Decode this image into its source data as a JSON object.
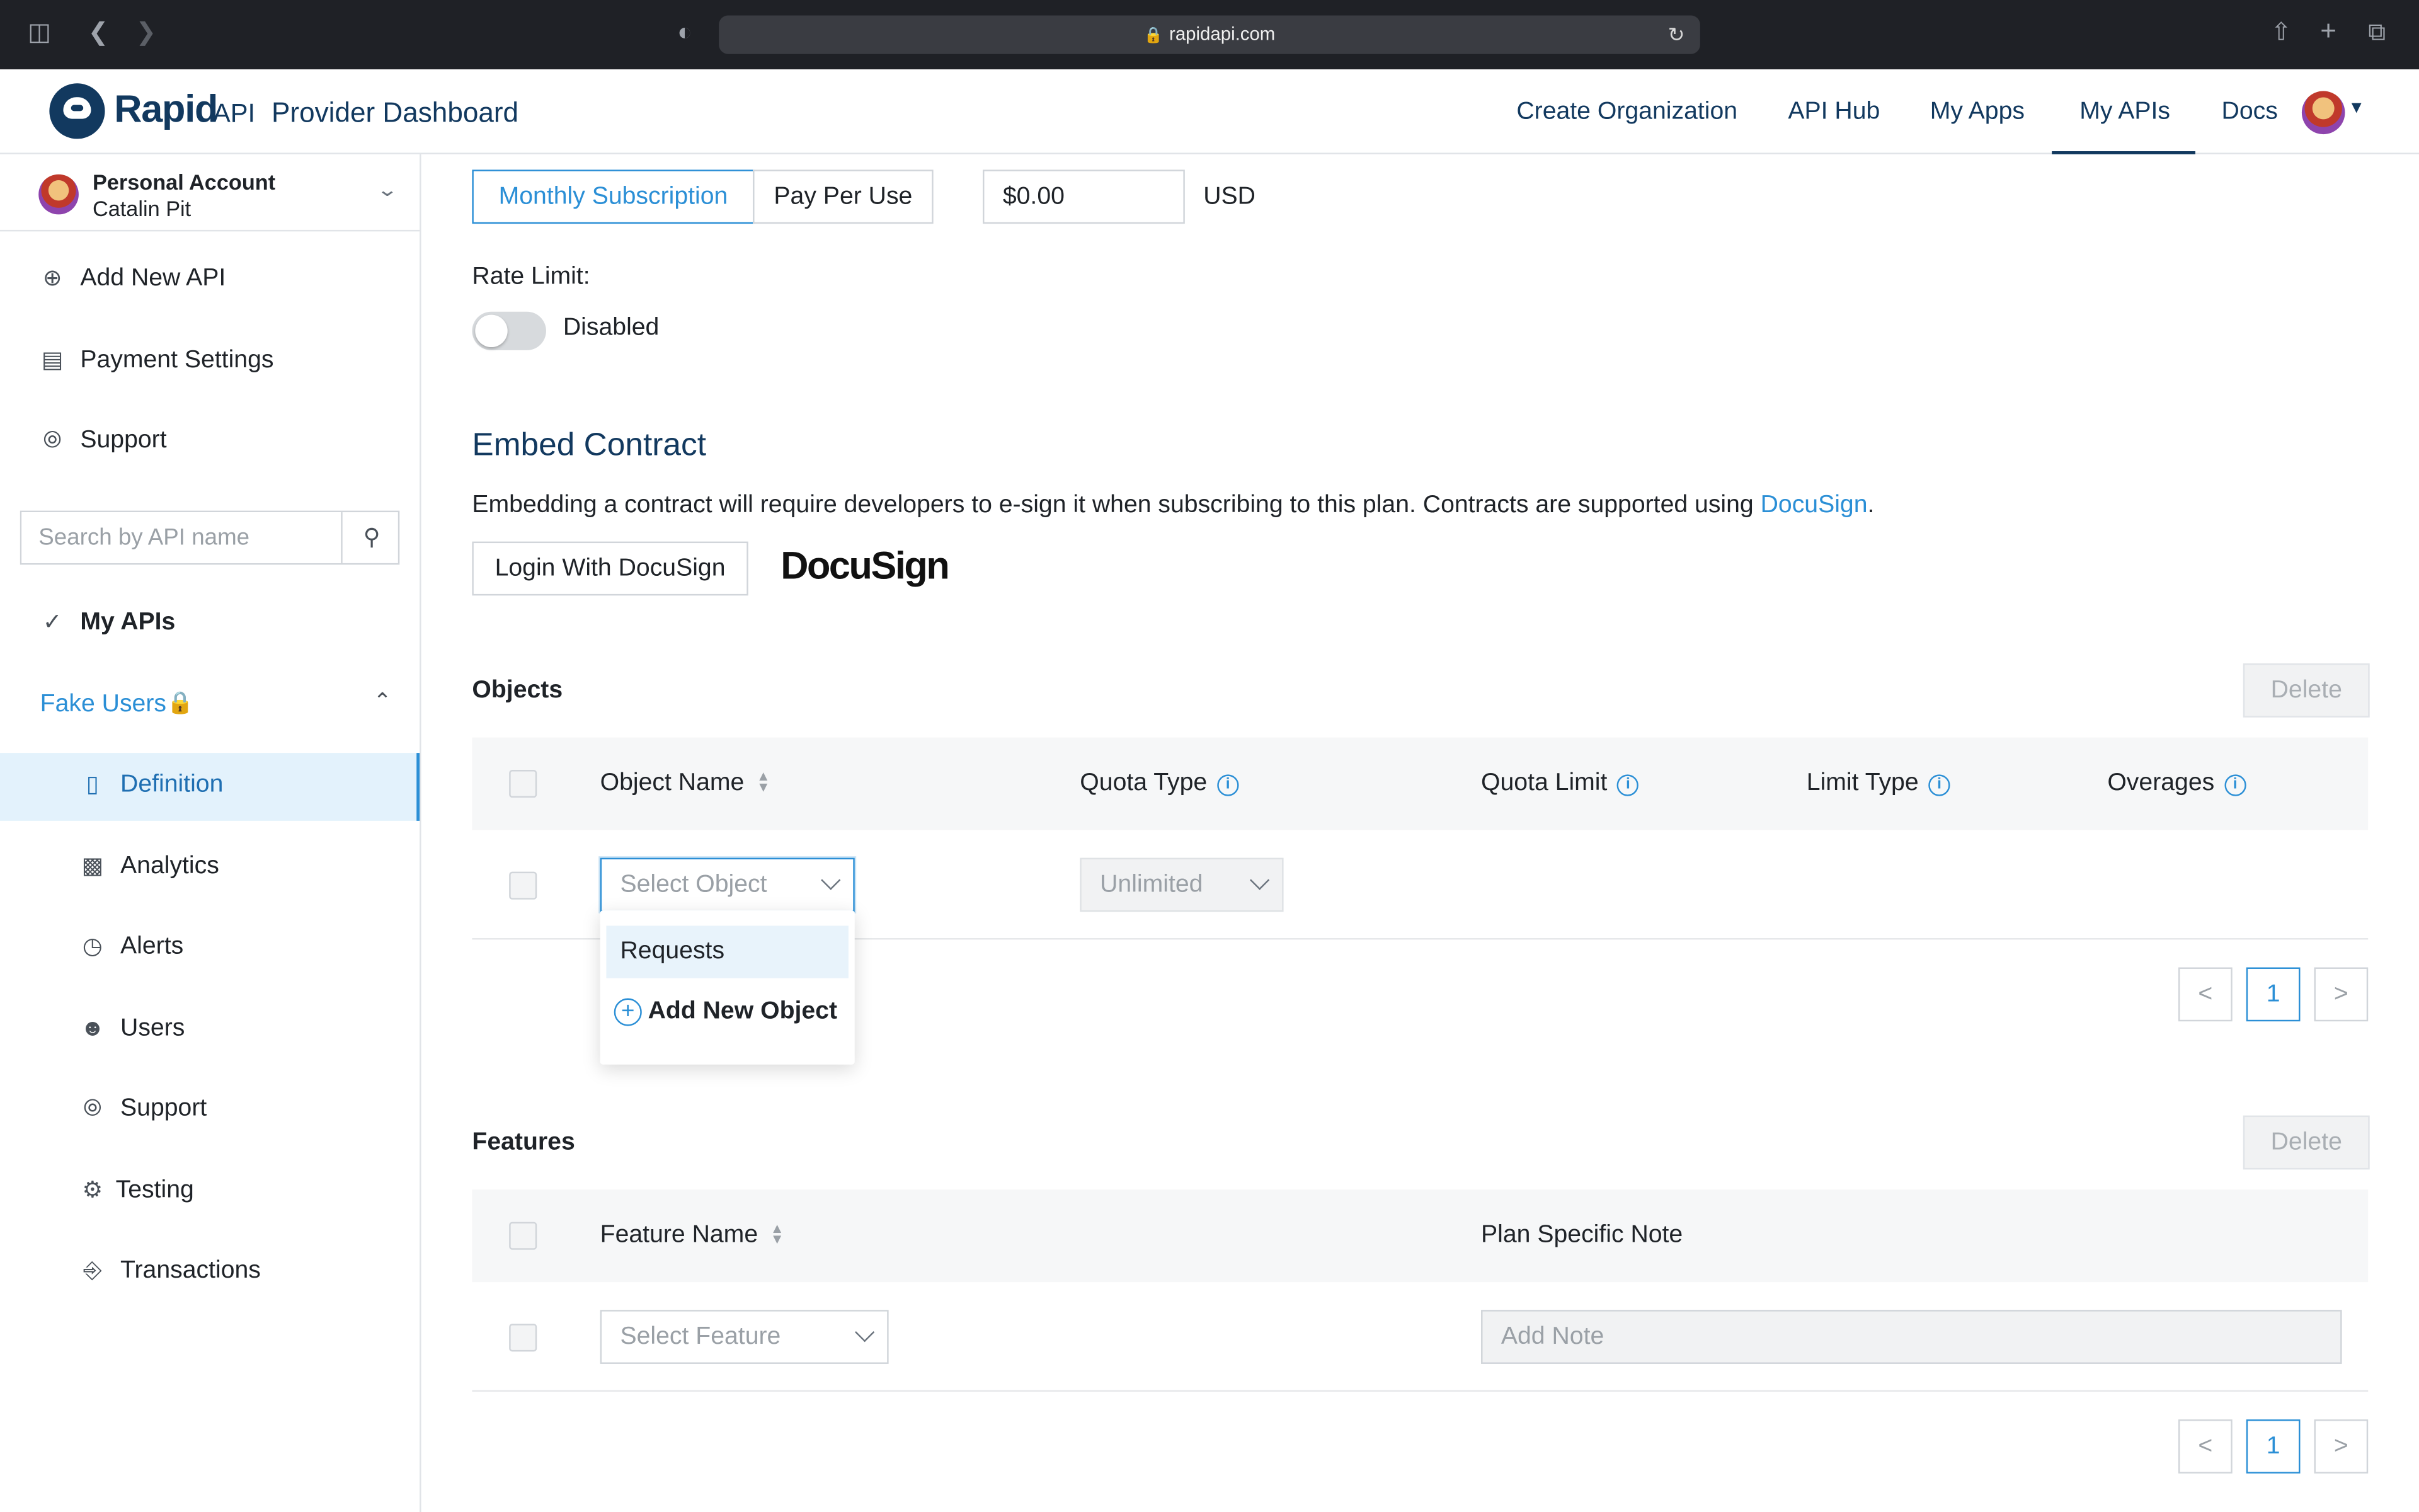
{
  "browser": {
    "url": "rapidapi.com"
  },
  "header": {
    "logo_rapid": "Rapid",
    "logo_api": "API",
    "title": "Provider Dashboard",
    "nav": [
      "Create Organization",
      "API Hub",
      "My Apps",
      "My APIs",
      "Docs"
    ],
    "active_nav": "My APIs"
  },
  "sidebar": {
    "account": {
      "name": "Personal Account",
      "user": "Catalin Pit"
    },
    "items": [
      "Add New API",
      "Payment Settings",
      "Support"
    ],
    "search_placeholder": "Search by API name",
    "my_apis": "My APIs",
    "api_name": "Fake Users",
    "sub_items": [
      "Definition",
      "Analytics",
      "Alerts",
      "Users",
      "Support",
      "Testing",
      "Transactions"
    ],
    "active_sub": "Definition"
  },
  "pricing": {
    "types": [
      "Monthly Subscription",
      "Pay Per Use"
    ],
    "selected_type": "Monthly Subscription",
    "price": "$0.00",
    "currency": "USD",
    "rate_limit_label": "Rate Limit:",
    "rate_limit_state": "Disabled",
    "rate_limit_enabled": false
  },
  "embed": {
    "title": "Embed Contract",
    "description": "Embedding a contract will require developers to e-sign it when subscribing to this plan. Contracts are supported using ",
    "link": "DocuSign",
    "suffix": ".",
    "button": "Login With DocuSign",
    "logo": "DocuSign"
  },
  "objects": {
    "heading": "Objects",
    "delete": "Delete",
    "columns": [
      "Object Name",
      "Quota Type",
      "Quota Limit",
      "Limit Type",
      "Overages"
    ],
    "row": {
      "object_placeholder": "Select Object",
      "quota_type": "Unlimited"
    },
    "dropdown": {
      "option": "Requests",
      "add": "Add New Object"
    },
    "page": "1"
  },
  "features": {
    "heading": "Features",
    "delete": "Delete",
    "columns": [
      "Feature Name",
      "Plan Specific Note"
    ],
    "row": {
      "feature_placeholder": "Select Feature",
      "note_placeholder": "Add Note"
    },
    "page": "1"
  },
  "colors": {
    "brand_navy": "#12395f",
    "accent_blue": "#2b8fd6",
    "active_bg": "#e3f2fc"
  }
}
